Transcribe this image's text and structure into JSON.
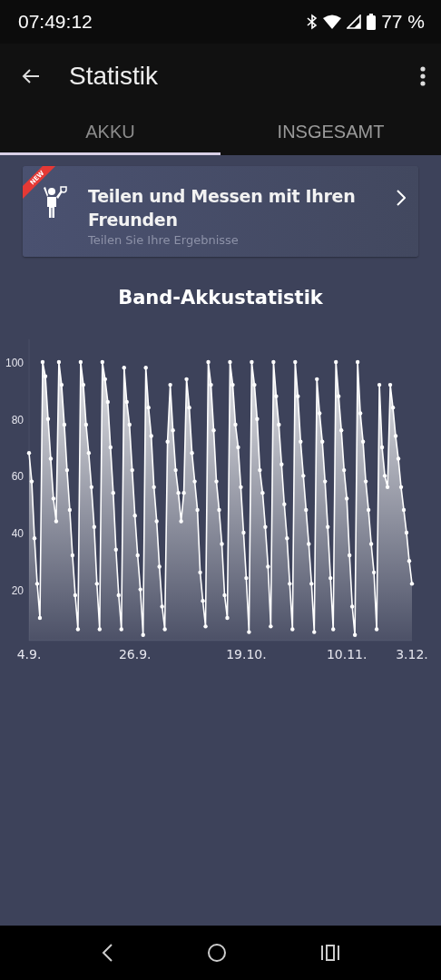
{
  "status_bar": {
    "time": "07:49:12",
    "battery": "77 %"
  },
  "app_bar": {
    "title": "Statistik"
  },
  "tabs": [
    {
      "label": "AKKU",
      "selected": true
    },
    {
      "label": "INSGESAMT",
      "selected": false
    }
  ],
  "banner": {
    "ribbon": "NEW",
    "title": "Teilen und Messen mit Ihren Freunden",
    "subtitle": "Teilen Sie Ihre Ergebnisse"
  },
  "chart": {
    "chart_data": {
      "type": "area",
      "title": "Band-Akkustatistik",
      "ylim": [
        2,
        108
      ],
      "yticks": [
        20,
        40,
        60,
        80,
        100
      ],
      "categories": [
        "4.9.",
        null,
        null,
        null,
        null,
        null,
        null,
        null,
        null,
        null,
        null,
        null,
        null,
        null,
        null,
        null,
        null,
        null,
        null,
        null,
        null,
        null,
        null,
        null,
        null,
        null,
        null,
        null,
        null,
        null,
        null,
        null,
        null,
        null,
        null,
        null,
        null,
        null,
        null,
        "26.9.",
        null,
        null,
        null,
        null,
        null,
        null,
        null,
        null,
        null,
        null,
        null,
        null,
        null,
        null,
        null,
        null,
        null,
        null,
        null,
        null,
        null,
        null,
        null,
        null,
        null,
        null,
        null,
        null,
        null,
        null,
        null,
        null,
        null,
        null,
        null,
        null,
        null,
        null,
        null,
        null,
        "19.10.",
        null,
        null,
        null,
        null,
        null,
        null,
        null,
        null,
        null,
        null,
        null,
        null,
        null,
        null,
        null,
        null,
        null,
        null,
        null,
        null,
        null,
        null,
        null,
        null,
        null,
        null,
        null,
        null,
        null,
        null,
        null,
        null,
        null,
        null,
        null,
        null,
        "10.11.",
        null,
        null,
        null,
        null,
        null,
        null,
        null,
        null,
        null,
        null,
        null,
        null,
        null,
        null,
        null,
        null,
        null,
        null,
        null,
        null,
        null,
        null,
        null,
        "3.12."
      ],
      "series": [
        {
          "color": "#ffffff",
          "values": [
            68,
            58,
            38,
            22,
            10,
            100,
            95,
            80,
            66,
            52,
            44,
            100,
            92,
            78,
            62,
            48,
            32,
            18,
            6,
            100,
            92,
            78,
            68,
            56,
            42,
            22,
            6,
            100,
            94,
            86,
            70,
            54,
            34,
            18,
            6,
            98,
            86,
            78,
            62,
            46,
            32,
            20,
            4,
            98,
            84,
            74,
            56,
            44,
            28,
            14,
            6,
            72,
            92,
            76,
            62,
            54,
            44,
            54,
            94,
            84,
            68,
            58,
            48,
            26,
            16,
            7,
            100,
            92,
            76,
            58,
            48,
            36,
            18,
            10,
            100,
            92,
            78,
            70,
            56,
            40,
            24,
            5,
            100,
            92,
            80,
            62,
            54,
            42,
            28,
            7,
            100,
            88,
            78,
            64,
            50,
            38,
            22,
            6,
            100,
            88,
            72,
            60,
            48,
            36,
            22,
            5,
            94,
            82,
            72,
            58,
            42,
            24,
            6,
            100,
            88,
            76,
            62,
            52,
            32,
            14,
            4,
            100,
            82,
            72,
            58,
            48,
            36,
            26,
            6,
            92,
            70,
            60,
            56,
            92,
            84,
            74,
            66,
            56,
            48,
            40,
            30,
            22
          ]
        }
      ]
    }
  }
}
